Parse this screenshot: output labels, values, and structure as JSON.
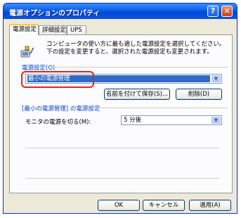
{
  "window": {
    "title": "電源オプションのプロパティ",
    "help_glyph": "?",
    "close_glyph": "✕"
  },
  "tabs": [
    {
      "label": "電源設定"
    },
    {
      "label": "詳細設定"
    },
    {
      "label": "UPS"
    }
  ],
  "intro_text": "コンピュータの使い方に最も適した電源設定を選択してください。下の設定を変更すると、選択された電源設定も変更されます。",
  "power_scheme": {
    "label": "電源設定(O)",
    "value": "最小の電源管理",
    "save_as_label": "名前を付けて保存(S)...",
    "delete_label": "削除(D)"
  },
  "settings_group": {
    "title": "[最小の電源管理] の電源設定",
    "monitor_label": "モニタの電源を切る(M):",
    "monitor_value": "5 分後"
  },
  "footer": {
    "ok_label": "OK",
    "cancel_label": "キャンセル",
    "apply_label": "適用(A)"
  },
  "colors": {
    "accent": "#316ac5",
    "annotation_ring": "#e0261c"
  }
}
